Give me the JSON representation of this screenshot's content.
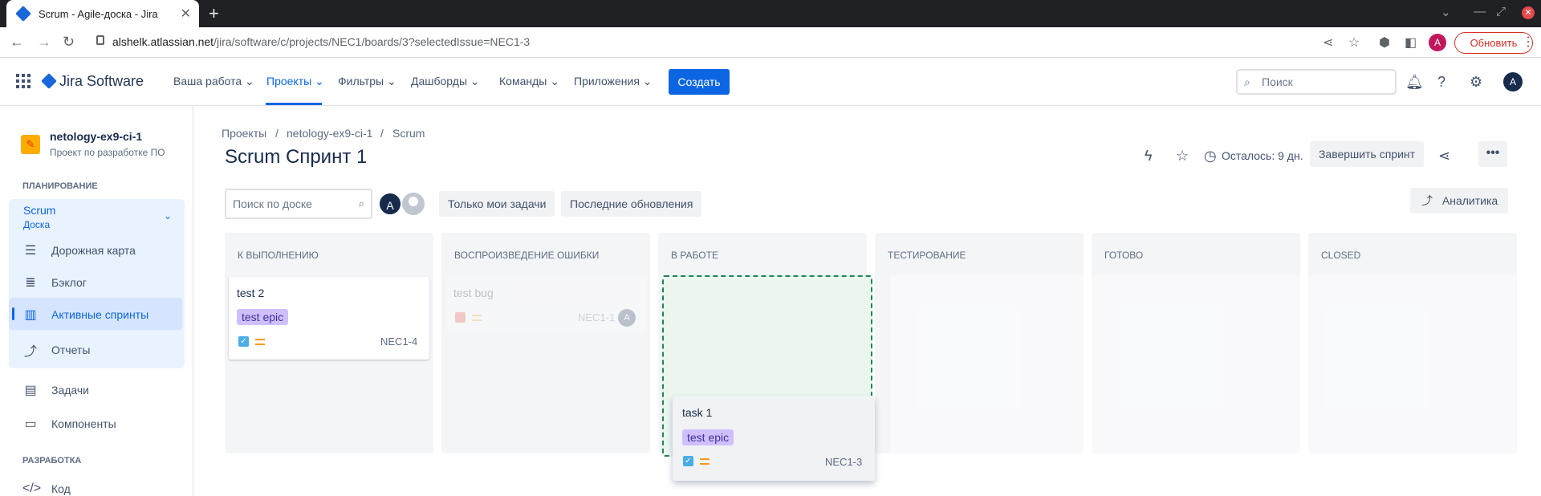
{
  "browser": {
    "tab_title": "Scrum - Agile-доска - Jira",
    "new_tab": "+",
    "url_host": "alshelk.atlassian.net",
    "url_path": "/jira/software/c/projects/NEC1/boards/3?selectedIssue=NEC1-3",
    "profile_initial": "A",
    "update_label": "Обновить"
  },
  "topnav": {
    "logo": "Jira Software",
    "items": [
      {
        "label": "Ваша работа ⌄"
      },
      {
        "label": "Проекты ⌄"
      },
      {
        "label": "Фильтры ⌄"
      },
      {
        "label": "Дашборды ⌄"
      },
      {
        "label": "Команды ⌄"
      },
      {
        "label": "Приложения ⌄"
      }
    ],
    "create_label": "Создать",
    "search_placeholder": "Поиск",
    "avatar_initial": "A"
  },
  "sidebar": {
    "project_name": "netology-ex9-ci-1",
    "project_sub": "Проект по разработке ПО",
    "planning_header": "ПЛАНИРОВАНИЕ",
    "scrum_title": "Scrum",
    "scrum_sub": "Доска",
    "items": [
      {
        "label": "Дорожная карта"
      },
      {
        "label": "Бэклог"
      },
      {
        "label": "Активные спринты"
      },
      {
        "label": "Отчеты"
      },
      {
        "label": "Задачи"
      },
      {
        "label": "Компоненты"
      }
    ],
    "dev_header": "РАЗРАБОТКА",
    "code_label": "Код"
  },
  "main": {
    "breadcrumb": [
      "Проекты",
      "netology-ex9-ci-1",
      "Scrum"
    ],
    "breadcrumb_sep": "/",
    "title": "Scrum Спринт 1",
    "remaining": "Осталось: 9 дн.",
    "finish_sprint": "Завершить спринт",
    "board_search_placeholder": "Поиск по доске",
    "avatar_initial": "A",
    "filter_mine": "Только мои задачи",
    "filter_recent": "Последние обновления",
    "analytics": "Аналитика"
  },
  "columns": [
    {
      "title": "К ВЫПОЛНЕНИЮ"
    },
    {
      "title": "ВОСПРОИЗВЕДЕНИЕ ОШИБКИ"
    },
    {
      "title": "В РАБОТЕ"
    },
    {
      "title": "ТЕСТИРОВАНИЕ"
    },
    {
      "title": "ГОТОВО"
    },
    {
      "title": "CLOSED"
    }
  ],
  "cards": {
    "todo": {
      "summary": "test 2",
      "epic": "test epic",
      "key": "NEC1-4"
    },
    "bug": {
      "summary": "test bug",
      "key": "NEC1-1",
      "assignee": "A"
    },
    "dragging": {
      "summary": "task 1",
      "epic": "test epic",
      "key": "NEC1-3"
    }
  },
  "colors": {
    "accent": "#0c66e4",
    "epic_bg": "#cfbfff",
    "epic_text": "#403294",
    "drop_border": "#1f845a"
  }
}
